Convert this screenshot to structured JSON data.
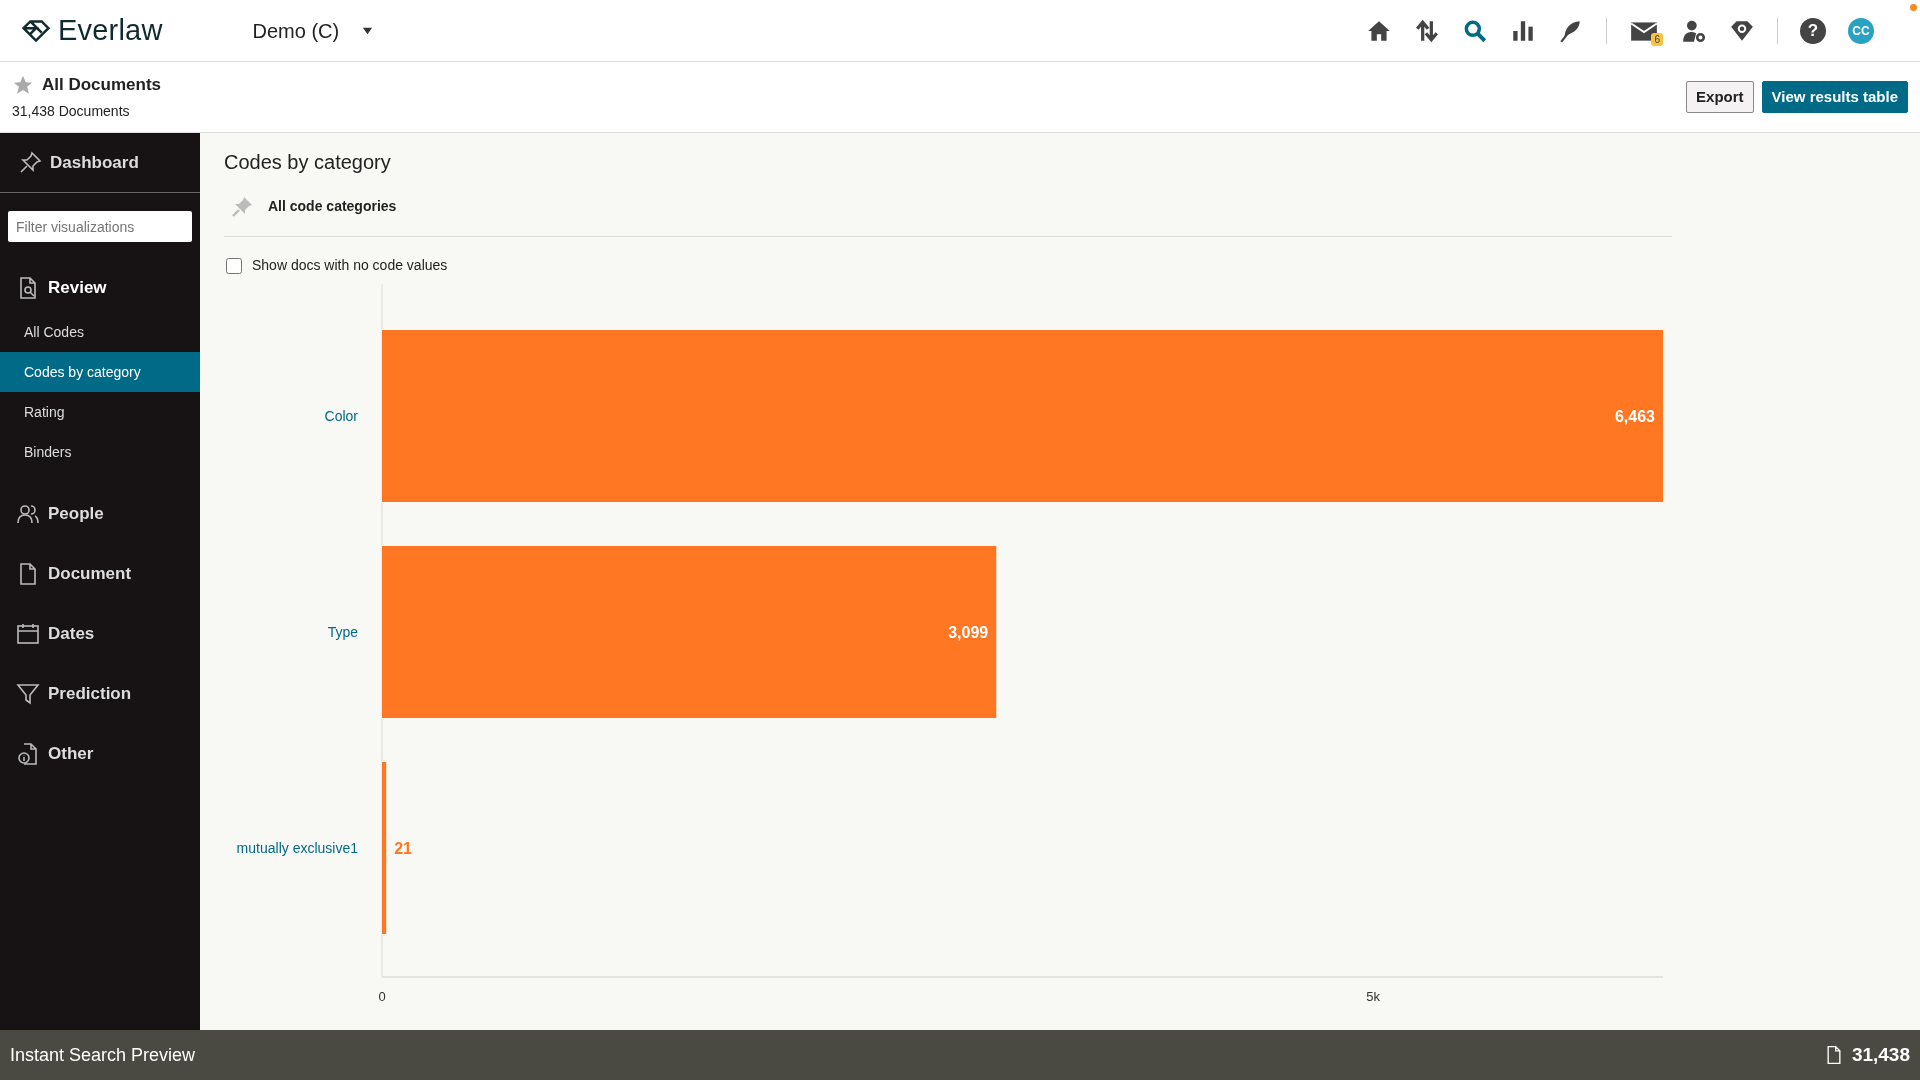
{
  "app": {
    "logo": "Everlaw",
    "project": "Demo (C)"
  },
  "toolbar": {
    "mail_badge": "6",
    "help": "?",
    "avatar": "CC"
  },
  "search_header": {
    "title": "All Documents",
    "count": "31,438 Documents",
    "buttons": [
      {
        "label": "Export",
        "kind": "secondary"
      },
      {
        "label": "View results table",
        "kind": "primary"
      }
    ]
  },
  "sidebar": {
    "dashboard": "Dashboard",
    "filter": {
      "placeholder": "Filter visualizations"
    },
    "sections": [
      {
        "label": "Review",
        "items": [
          {
            "label": "All Codes",
            "selected": false
          },
          {
            "label": "Codes by category",
            "selected": true
          },
          {
            "label": "Rating",
            "selected": false
          },
          {
            "label": "Binders",
            "selected": false
          }
        ]
      },
      {
        "label": "People"
      },
      {
        "label": "Document"
      },
      {
        "label": "Dates"
      },
      {
        "label": "Prediction"
      },
      {
        "label": "Other"
      }
    ]
  },
  "panel": {
    "title": "Codes by category",
    "pinned_label": "All code categories",
    "checkbox": {
      "label": "Show docs with no code values",
      "checked": false
    },
    "chart_data": {
      "type": "bar",
      "orientation": "horizontal",
      "categories": [
        "Color",
        "Type",
        "mutually exclusive1"
      ],
      "series": [
        {
          "color": "#ff7722",
          "values": [
            6463,
            3099,
            21
          ]
        }
      ],
      "xlim": [
        0,
        6463
      ],
      "xticks": [
        0,
        {
          "value": 5000,
          "label": "5k"
        }
      ],
      "value_labels": [
        "6,463",
        "3,099",
        "21"
      ]
    }
  },
  "status_bar": {
    "label": "Instant Search Preview",
    "count": "31,438"
  }
}
